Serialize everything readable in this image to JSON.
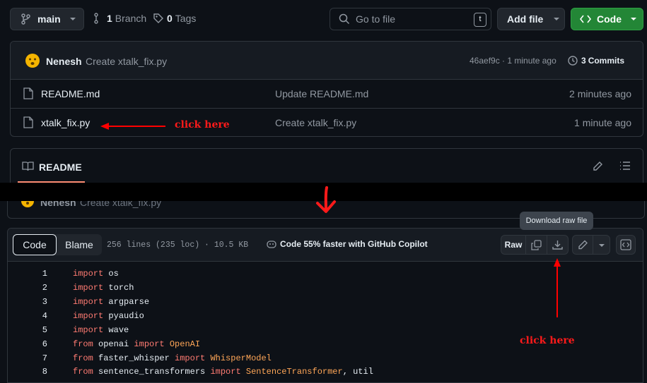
{
  "branch_bar": {
    "branch_name": "main",
    "branch_count": "1",
    "branch_label": "Branch",
    "tag_count": "0",
    "tag_label": "Tags",
    "goto_placeholder": "Go to file",
    "goto_shortcut": "t",
    "add_file_label": "Add file",
    "code_label": "Code"
  },
  "commit_header": {
    "author": "Nenesh",
    "message": "Create xtalk_fix.py",
    "meta": "46aef9c · 1 minute ago",
    "commits_count": "3",
    "commits_label": "Commits"
  },
  "files": [
    {
      "name": "README.md",
      "commit_message": "Update README.md",
      "time": "2 minutes ago"
    },
    {
      "name": "xtalk_fix.py",
      "commit_message": "Create xtalk_fix.py",
      "time": "1 minute ago"
    }
  ],
  "readme_tab": "README",
  "annotations": {
    "click_here_1": "click here",
    "click_here_2": "click here"
  },
  "file_view": {
    "author": "Nenesh",
    "message": "Create xtalk_fix.py",
    "tab_code": "Code",
    "tab_blame": "Blame",
    "stats": "256 lines (235 loc) · 10.5 KB",
    "copilot": "Code 55% faster with GitHub Copilot",
    "raw_label": "Raw",
    "tooltip": "Download raw file"
  },
  "code_lines": [
    {
      "n": "1",
      "parts": [
        {
          "t": "import",
          "c": "kw"
        },
        {
          "t": " os",
          "c": ""
        }
      ]
    },
    {
      "n": "2",
      "parts": [
        {
          "t": "import",
          "c": "kw"
        },
        {
          "t": " torch",
          "c": ""
        }
      ]
    },
    {
      "n": "3",
      "parts": [
        {
          "t": "import",
          "c": "kw"
        },
        {
          "t": " argparse",
          "c": ""
        }
      ]
    },
    {
      "n": "4",
      "parts": [
        {
          "t": "import",
          "c": "kw"
        },
        {
          "t": " pyaudio",
          "c": ""
        }
      ]
    },
    {
      "n": "5",
      "parts": [
        {
          "t": "import",
          "c": "kw"
        },
        {
          "t": " wave",
          "c": ""
        }
      ]
    },
    {
      "n": "6",
      "parts": [
        {
          "t": "from",
          "c": "kw"
        },
        {
          "t": " openai ",
          "c": ""
        },
        {
          "t": "import",
          "c": "kw"
        },
        {
          "t": " ",
          "c": ""
        },
        {
          "t": "OpenAI",
          "c": "cls"
        }
      ]
    },
    {
      "n": "7",
      "parts": [
        {
          "t": "from",
          "c": "kw"
        },
        {
          "t": " faster_whisper ",
          "c": ""
        },
        {
          "t": "import",
          "c": "kw"
        },
        {
          "t": " ",
          "c": ""
        },
        {
          "t": "WhisperModel",
          "c": "cls"
        }
      ]
    },
    {
      "n": "8",
      "parts": [
        {
          "t": "from",
          "c": "kw"
        },
        {
          "t": " sentence_transformers ",
          "c": ""
        },
        {
          "t": "import",
          "c": "kw"
        },
        {
          "t": " ",
          "c": ""
        },
        {
          "t": "SentenceTransformer",
          "c": "cls"
        },
        {
          "t": ", util",
          "c": ""
        }
      ]
    }
  ],
  "colors": {
    "background": "#0d1117",
    "border": "#30363d",
    "button": "#21262d",
    "green": "#238636",
    "keyword": "#ff7b72",
    "class_name": "#ffa657",
    "annotation": "#ff0000",
    "tab_underline": "#fd8c73"
  }
}
